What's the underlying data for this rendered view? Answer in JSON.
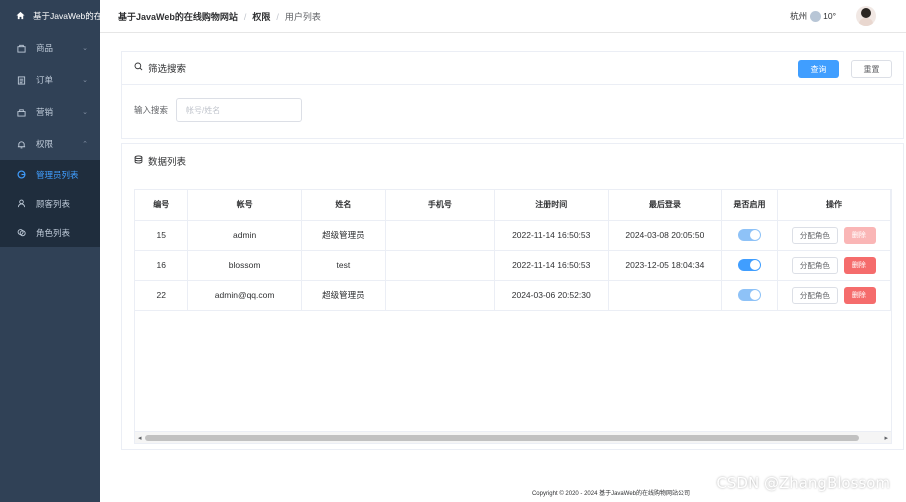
{
  "sidebar": {
    "app_title": "基于JavaWeb的在线购物网站",
    "menus": [
      {
        "label": "商品",
        "icon": "goods-icon"
      },
      {
        "label": "订单",
        "icon": "order-icon"
      },
      {
        "label": "营销",
        "icon": "marketing-icon"
      },
      {
        "label": "权限",
        "icon": "bell-icon"
      }
    ],
    "sub_items": [
      {
        "label": "管理员列表",
        "active": true
      },
      {
        "label": "顾客列表"
      },
      {
        "label": "角色列表"
      }
    ]
  },
  "header": {
    "breadcrumb": [
      "基于JavaWeb的在线购物网站",
      "权限",
      "用户列表"
    ],
    "city": "杭州",
    "temperature": "10°"
  },
  "filter": {
    "title": "筛选搜索",
    "query_label": "查询",
    "reset_label": "重置",
    "input_label": "输入搜索",
    "input_placeholder": "帐号/姓名"
  },
  "list": {
    "title": "数据列表",
    "columns": [
      "编号",
      "帐号",
      "姓名",
      "手机号",
      "注册时间",
      "最后登录",
      "是否启用",
      "操作"
    ],
    "rows": [
      {
        "id": "15",
        "account": "admin",
        "name": "超级管理员",
        "phone": "",
        "registered": "2022-11-14 16:50:53",
        "last_login": "2024-03-08 20:05:50",
        "enabled": true
      },
      {
        "id": "16",
        "account": "blossom",
        "name": "test",
        "phone": "",
        "registered": "2022-11-14 16:50:53",
        "last_login": "2023-12-05 18:04:34",
        "enabled": true
      },
      {
        "id": "22",
        "account": "admin@qq.com",
        "name": "超级管理员",
        "phone": "",
        "registered": "2024-03-06 20:52:30",
        "last_login": "",
        "enabled": true
      }
    ],
    "assign_label": "分配角色",
    "delete_label": "删除"
  },
  "footer": {
    "copyright": "Copyright © 2020 - 2024   基于JavaWeb的在线购物网站公司"
  },
  "watermark": "CSDN @ZhangBlossom",
  "colors": {
    "sidebar_bg": "#304156",
    "primary": "#409eff",
    "danger": "#f56c6c"
  }
}
